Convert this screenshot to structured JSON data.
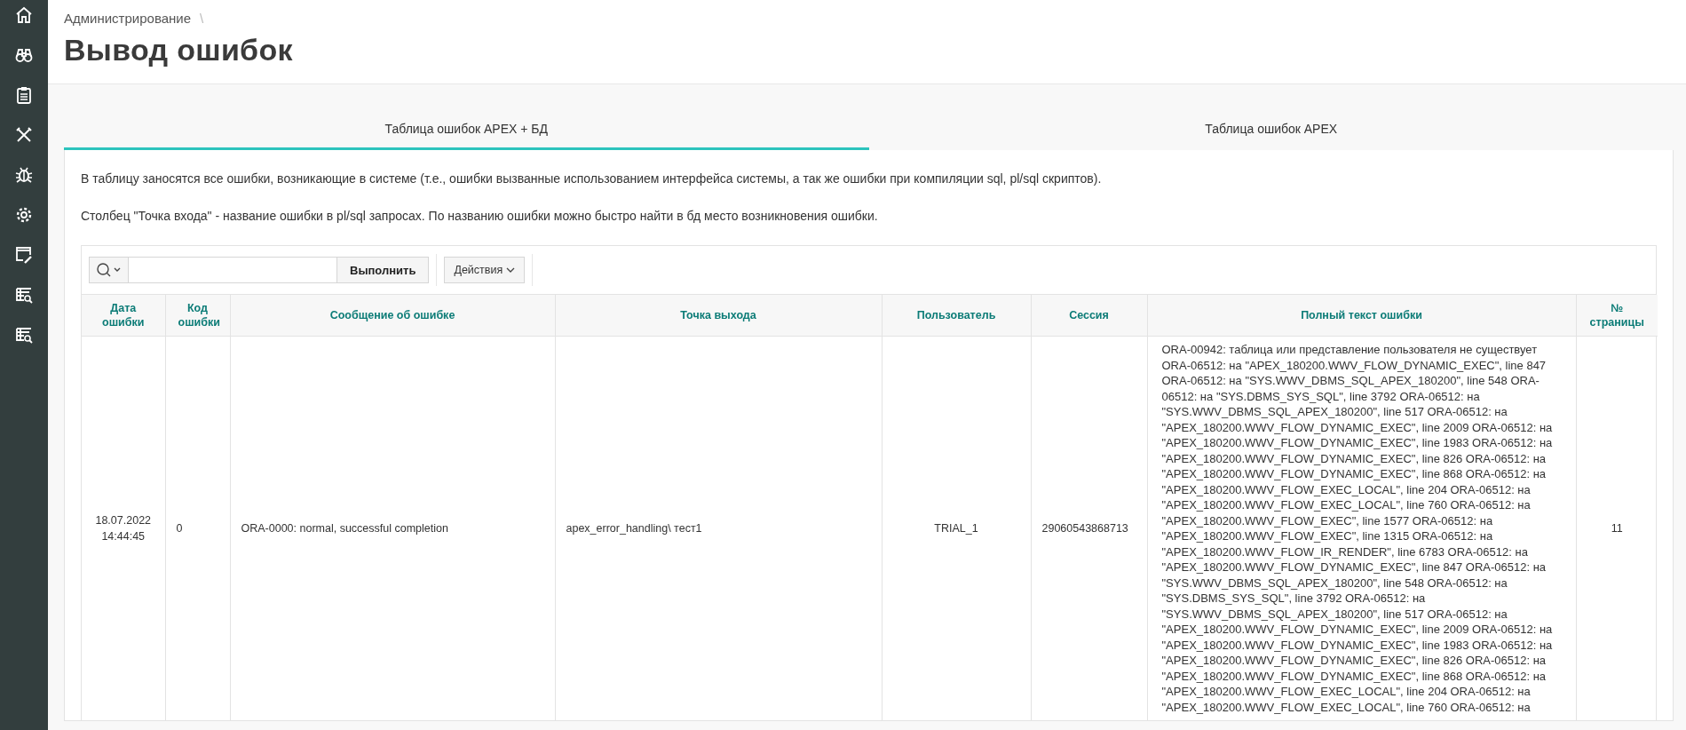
{
  "breadcrumb": {
    "items": [
      "Администрирование"
    ],
    "separator": "\\"
  },
  "page_title": "Вывод ошибок",
  "tabs": [
    {
      "label": "Таблица ошибок APEX + БД",
      "selected": true
    },
    {
      "label": "Таблица ошибок APEX",
      "selected": false
    }
  ],
  "description": [
    "В таблицу заносятся все ошибки, возникающие в системе (т.е., ошибки вызванные использованием интерфейса системы, а так же ошибки при компиляции sql, pl/sql скриптов).",
    "Столбец \"Точка входа\" - название ошибки в pl/sql запросах. По названию ошибки можно быстро найти в бд место возникновения ошибки."
  ],
  "toolbar": {
    "go_button": "Выполнить",
    "actions_button": "Действия"
  },
  "table": {
    "columns": [
      "Дата ошибки",
      "Код ошибки",
      "Сообщение об ошибке",
      "Точка выхода",
      "Пользователь",
      "Сессия",
      "Полный текст ошибки",
      "№ страницы"
    ],
    "rows": [
      {
        "cells": [
          "18.07.2022 14:44:45",
          "0",
          "ORA-0000: normal, successful completion",
          "apex_error_handling\\ тест1",
          "TRIAL_1",
          "29060543868713",
          "ORA-00942: таблица или представление пользователя не существует ORA-06512: на \"APEX_180200.WWV_FLOW_DYNAMIC_EXEC\", line 847 ORA-06512: на \"SYS.WWV_DBMS_SQL_APEX_180200\", line 548 ORA-06512: на \"SYS.DBMS_SYS_SQL\", line 3792 ORA-06512: на \"SYS.WWV_DBMS_SQL_APEX_180200\", line 517 ORA-06512: на \"APEX_180200.WWV_FLOW_DYNAMIC_EXEC\", line 2009 ORA-06512: на \"APEX_180200.WWV_FLOW_DYNAMIC_EXEC\", line 1983 ORA-06512: на \"APEX_180200.WWV_FLOW_DYNAMIC_EXEC\", line 826 ORA-06512: на \"APEX_180200.WWV_FLOW_DYNAMIC_EXEC\", line 868 ORA-06512: на \"APEX_180200.WWV_FLOW_EXEC_LOCAL\", line 204 ORA-06512: на \"APEX_180200.WWV_FLOW_EXEC_LOCAL\", line 760 ORA-06512: на \"APEX_180200.WWV_FLOW_EXEC\", line 1577 ORA-06512: на \"APEX_180200.WWV_FLOW_EXEC\", line 1315 ORA-06512: на \"APEX_180200.WWV_FLOW_IR_RENDER\", line 6783 ORA-06512: на \"APEX_180200.WWV_FLOW_DYNAMIC_EXEC\", line 847 ORA-06512: на \"SYS.WWV_DBMS_SQL_APEX_180200\", line 548 ORA-06512: на \"SYS.DBMS_SYS_SQL\", line 3792 ORA-06512: на \"SYS.WWV_DBMS_SQL_APEX_180200\", line 517 ORA-06512: на \"APEX_180200.WWV_FLOW_DYNAMIC_EXEC\", line 2009 ORA-06512: на \"APEX_180200.WWV_FLOW_DYNAMIC_EXEC\", line 1983 ORA-06512: на \"APEX_180200.WWV_FLOW_DYNAMIC_EXEC\", line 826 ORA-06512: на \"APEX_180200.WWV_FLOW_DYNAMIC_EXEC\", line 868 ORA-06512: на \"APEX_180200.WWV_FLOW_EXEC_LOCAL\", line 204 ORA-06512: на \"APEX_180200.WWV_FLOW_EXEC_LOCAL\", line 760 ORA-06512: на",
          "11"
        ]
      }
    ]
  }
}
